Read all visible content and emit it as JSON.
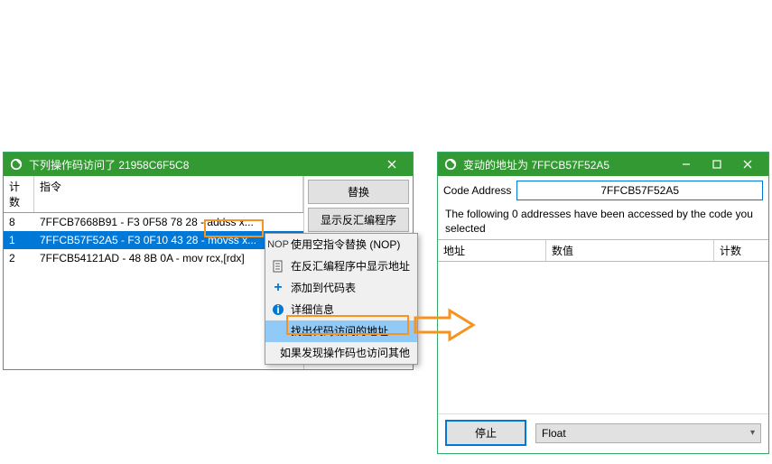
{
  "left_window": {
    "title": "下列操作码访问了 21958C6F5C8",
    "columns": {
      "count": "计数",
      "instruction": "指令"
    },
    "rows": [
      {
        "count": "8",
        "text": "7FFCB7668B91 - F3 0F58 78 28  - addss x..."
      },
      {
        "count": "1",
        "text": "7FFCB57F52A5 - F3 0F10 43 28  - movss x..."
      },
      {
        "count": "2",
        "text": "7FFCB54121AD - 48 8B 0A  - mov rcx,[rdx]"
      }
    ],
    "buttons": {
      "replace": "替换",
      "show_disasm": "显示反汇编程序"
    }
  },
  "context_menu": {
    "items": [
      {
        "icon": "NOP",
        "label": "使用空指令替换 (NOP)"
      },
      {
        "icon": "doc",
        "label": "在反汇编程序中显示地址"
      },
      {
        "icon": "plus",
        "label": "添加到代码表"
      },
      {
        "icon": "info",
        "label": "详细信息"
      },
      {
        "icon": "",
        "label": "找出代码访问的地址"
      },
      {
        "icon": "",
        "label": "如果发现操作码也访问其他"
      }
    ]
  },
  "right_window": {
    "title": "变动的地址为 7FFCB57F52A5",
    "code_address_label": "Code Address",
    "code_address_value": "7FFCB57F52A5",
    "message": "The following 0 addresses have been accessed by the code you selected",
    "columns": {
      "address": "地址",
      "value": "数值",
      "count": "计数"
    },
    "stop_label": "停止",
    "type_value": "Float"
  }
}
